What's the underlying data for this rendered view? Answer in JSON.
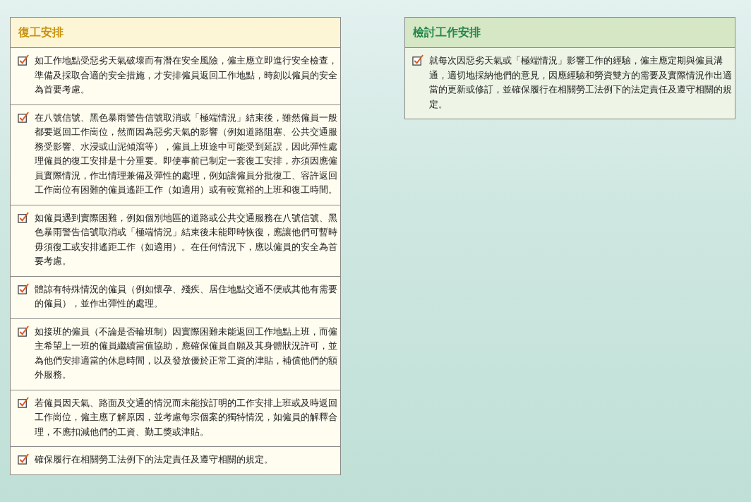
{
  "panels": [
    {
      "title": "復工安排",
      "color": "#c8920c",
      "items": [
        "如工作地點受惡劣天氣破壞而有潛在安全風險，僱主應立即進行安全檢查，準備及採取合適的安全措施，才安排僱員返回工作地點，時刻以僱員的安全為首要考慮。",
        "在八號信號、黑色暴雨警告信號取消或「極端情況」結束後，雖然僱員一般都要返回工作崗位，然而因為惡劣天氣的影響（例如道路阻塞、公共交通服務受影響、水浸或山泥傾瀉等），僱員上班途中可能受到延誤，因此彈性處理僱員的復工安排是十分重要。即使事前已制定一套復工安排，亦須因應僱員實際情況，作出情理兼備及彈性的處理，例如讓僱員分批復工、容許返回工作崗位有困難的僱員遙距工作（如適用）或有較寬裕的上班和復工時間。",
        "如僱員遇到實際困難，例如個別地區的道路或公共交通服務在八號信號、黑色暴雨警告信號取消或「極端情況」結束後未能即時恢復，應讓他們可暫時毋須復工或安排遙距工作（如適用）。在任何情況下，應以僱員的安全為首要考慮。",
        "體諒有特殊情況的僱員（例如懷孕、殘疾、居住地點交通不便或其他有需要的僱員），並作出彈性的處理。",
        "如接班的僱員（不論是否輪班制）因實際困難未能返回工作地點上班，而僱主希望上一班的僱員繼續當值協助，應確保僱員自願及其身體狀況許可，並為他們安排適當的休息時間，以及發放優於正常工資的津貼，補償他們的額外服務。",
        "若僱員因天氣、路面及交通的情況而未能按訂明的工作安排上班或及時返回工作崗位，僱主應了解原因，並考慮每宗個案的獨特情況，如僱員的解釋合理，不應扣減他們的工資、勤工獎或津貼。",
        "確保履行在相關勞工法例下的法定責任及遵守相關的規定。"
      ]
    },
    {
      "title": "檢討工作安排",
      "color": "#23874a",
      "items": [
        "就每次因惡劣天氣或「極端情況」影響工作的經驗，僱主應定期與僱員溝通，適切地採納他們的意見，因應經驗和勞資雙方的需要及實際情況作出適當的更新或修訂，並確保履行在相關勞工法例下的法定責任及遵守相關的規定。"
      ]
    }
  ]
}
